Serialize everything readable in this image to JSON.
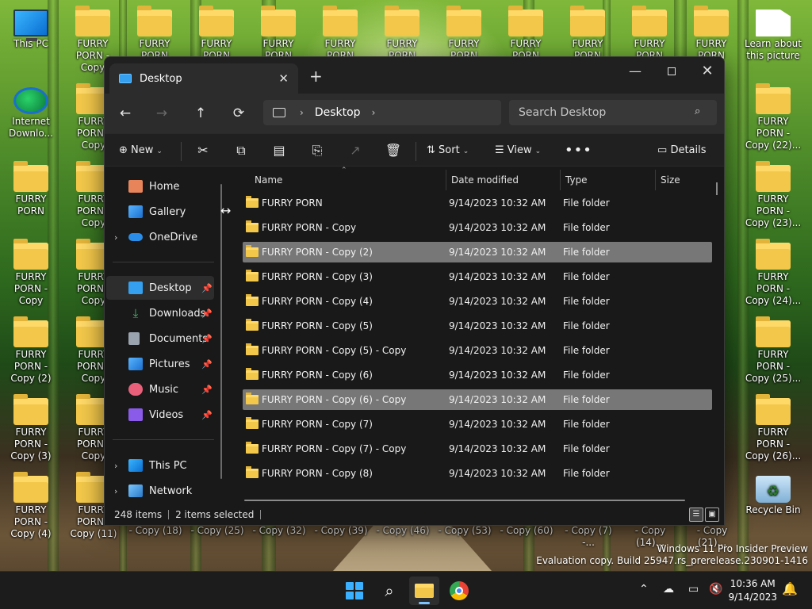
{
  "desktop": {
    "top_row": [
      {
        "label": "This PC",
        "kind": "pc"
      },
      {
        "label": "FURRY PORN - Copy",
        "kind": "folder"
      },
      {
        "label": "FURRY PORN",
        "kind": "folder"
      },
      {
        "label": "FURRY PORN",
        "kind": "folder"
      },
      {
        "label": "FURRY PORN",
        "kind": "folder"
      },
      {
        "label": "FURRY PORN",
        "kind": "folder"
      },
      {
        "label": "FURRY PORN",
        "kind": "folder"
      },
      {
        "label": "FURRY PORN",
        "kind": "folder"
      },
      {
        "label": "FURRY PORN",
        "kind": "folder"
      },
      {
        "label": "FURRY PORN",
        "kind": "folder"
      },
      {
        "label": "FURRY PORN",
        "kind": "folder"
      },
      {
        "label": "FURRY PORN",
        "kind": "folder"
      },
      {
        "label": "Learn about this picture",
        "kind": "doc"
      }
    ],
    "left_col": [
      {
        "label": "Internet Downlo...",
        "kind": "idm"
      },
      {
        "label": "FURRY PORN",
        "kind": "folder"
      },
      {
        "label": "FURRY PORN - Copy",
        "kind": "folder"
      },
      {
        "label": "FURRY PORN - Copy (2)",
        "kind": "folder"
      },
      {
        "label": "FURRY PORN - Copy (3)",
        "kind": "folder"
      },
      {
        "label": "FURRY PORN - Copy (4)",
        "kind": "folder"
      }
    ],
    "second_col": [
      {
        "label": "FURRY PORN - Copy",
        "kind": "folder"
      },
      {
        "label": "FURRY PORN - Copy",
        "kind": "folder"
      },
      {
        "label": "FURRY PORN - Copy",
        "kind": "folder"
      },
      {
        "label": "FURRY PORN - Copy",
        "kind": "folder"
      },
      {
        "label": "FURRY PORN - Copy",
        "kind": "folder"
      },
      {
        "label": "FURRY PORN - Copy (11)",
        "kind": "folder"
      }
    ],
    "right_col": [
      {
        "label": "FURRY PORN - Copy (22)...",
        "kind": "folder"
      },
      {
        "label": "FURRY PORN - Copy (23)...",
        "kind": "folder"
      },
      {
        "label": "FURRY PORN - Copy (24)...",
        "kind": "folder"
      },
      {
        "label": "FURRY PORN - Copy (25)...",
        "kind": "folder"
      },
      {
        "label": "FURRY PORN - Copy (26)...",
        "kind": "folder"
      },
      {
        "label": "Recycle Bin",
        "kind": "bin"
      }
    ],
    "bottom_labels": [
      "- Copy (18)",
      "- Copy (25)",
      "- Copy (32)",
      "- Copy (39)",
      "- Copy (46)",
      "- Copy (53)",
      "- Copy (60)",
      "- Copy (7) -...",
      "- Copy (14)...",
      "- Copy (21)..."
    ]
  },
  "window": {
    "tab_title": "Desktop",
    "tab_close": "✕",
    "new_tab": "+",
    "minimize": "—",
    "close": "✕",
    "nav": {
      "back": "←",
      "forward": "→",
      "up": "↑",
      "refresh": "⟳"
    },
    "address_chevron": "›",
    "address": "Desktop",
    "search_placeholder": "Search Desktop",
    "toolbar": {
      "new": "New",
      "sort": "Sort",
      "view": "View",
      "more": "•••",
      "details": "Details"
    },
    "sidebar": {
      "home": "Home",
      "gallery": "Gallery",
      "onedrive": "OneDrive",
      "desktop": "Desktop",
      "downloads": "Downloads",
      "documents": "Documents",
      "pictures": "Pictures",
      "music": "Music",
      "videos": "Videos",
      "thispc": "This PC",
      "network": "Network"
    },
    "columns": {
      "name": "Name",
      "date": "Date modified",
      "type": "Type",
      "size": "Size"
    },
    "rows": [
      {
        "name": "FURRY PORN",
        "date": "9/14/2023 10:32 AM",
        "type": "File folder",
        "selected": false
      },
      {
        "name": "FURRY PORN - Copy",
        "date": "9/14/2023 10:32 AM",
        "type": "File folder",
        "selected": false
      },
      {
        "name": "FURRY PORN - Copy (2)",
        "date": "9/14/2023 10:32 AM",
        "type": "File folder",
        "selected": true
      },
      {
        "name": "FURRY PORN - Copy (3)",
        "date": "9/14/2023 10:32 AM",
        "type": "File folder",
        "selected": false
      },
      {
        "name": "FURRY PORN - Copy (4)",
        "date": "9/14/2023 10:32 AM",
        "type": "File folder",
        "selected": false
      },
      {
        "name": "FURRY PORN - Copy (5)",
        "date": "9/14/2023 10:32 AM",
        "type": "File folder",
        "selected": false
      },
      {
        "name": "FURRY PORN - Copy (5) - Copy",
        "date": "9/14/2023 10:32 AM",
        "type": "File folder",
        "selected": false
      },
      {
        "name": "FURRY PORN - Copy (6)",
        "date": "9/14/2023 10:32 AM",
        "type": "File folder",
        "selected": false
      },
      {
        "name": "FURRY PORN - Copy (6) - Copy",
        "date": "9/14/2023 10:32 AM",
        "type": "File folder",
        "selected": true
      },
      {
        "name": "FURRY PORN - Copy (7)",
        "date": "9/14/2023 10:32 AM",
        "type": "File folder",
        "selected": false
      },
      {
        "name": "FURRY PORN - Copy (7) - Copy",
        "date": "9/14/2023 10:32 AM",
        "type": "File folder",
        "selected": false
      },
      {
        "name": "FURRY PORN - Copy (8)",
        "date": "9/14/2023 10:32 AM",
        "type": "File folder",
        "selected": false
      }
    ],
    "status": {
      "count": "248 items",
      "selected": "2 items selected"
    }
  },
  "watermark": {
    "line1": "Windows 11 Pro Insider Preview",
    "line2": "Evaluation copy. Build 25947.rs_prerelease.230901-1416"
  },
  "taskbar": {
    "time": "10:36 AM",
    "date": "9/14/2023"
  },
  "colors": {
    "folder": "#f3c84a",
    "accent": "#3ab0ff",
    "selection": "#777777",
    "window_bg": "#191919"
  }
}
